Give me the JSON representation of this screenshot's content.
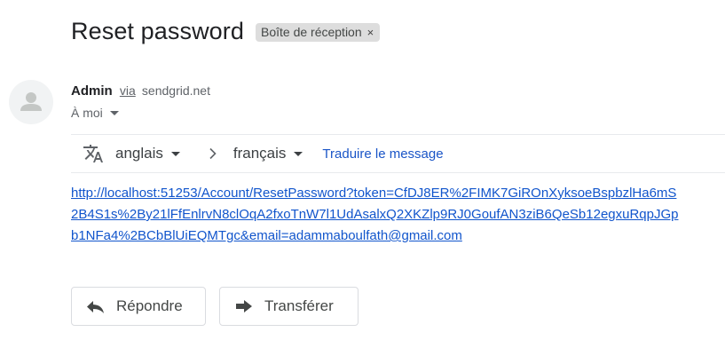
{
  "subject": {
    "title": "Reset password",
    "label": "Boîte de réception",
    "label_remove": "×"
  },
  "sender": {
    "name": "Admin",
    "via": "via",
    "domain": "sendgrid.net",
    "recipient": "À moi"
  },
  "translate": {
    "icon": "translate-icon",
    "source_language": "anglais",
    "target_language": "français",
    "action_label": "Traduire le message"
  },
  "body": {
    "link_lines": [
      "http://localhost:51253/Account/ResetPassword?token=CfDJ8ER%2FIMK7GiROnXyksoeBspbzlHa6mS",
      "2B4S1s%2By21lFfEnlrvN8clOqA2fxoTnW7l1UdAsalxQ2XKZlp9RJ0GoufAN3ziB6QeSb12egxuRqpJGp",
      "b1NFa4%2BCbBlUiEQMTgc&email=adammaboulfath@gmail.com"
    ]
  },
  "actions": {
    "reply_label": "Répondre",
    "reply_icon": "reply-icon",
    "forward_label": "Transférer",
    "forward_icon": "forward-icon"
  },
  "colors": {
    "link": "#1155cc",
    "translate_link": "#1a55c7",
    "chip_background": "#dddddd",
    "border": "#dadce0"
  }
}
